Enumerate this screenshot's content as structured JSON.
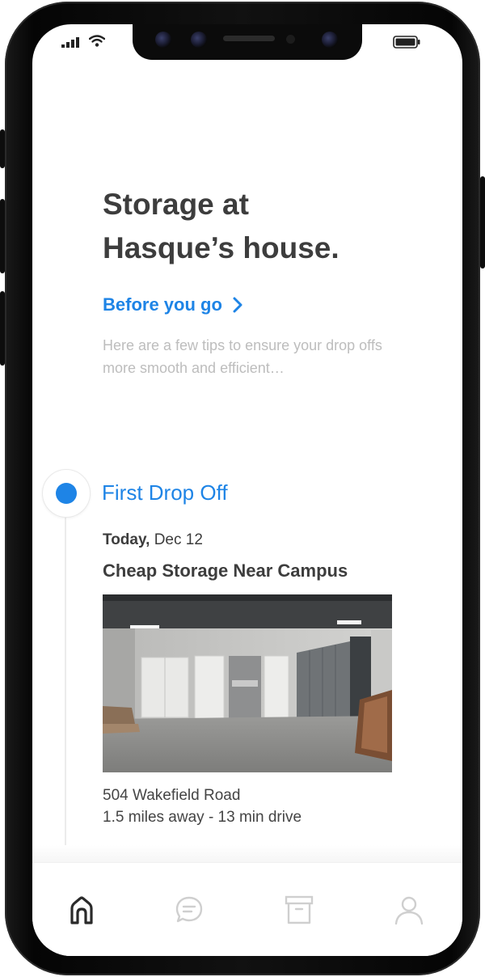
{
  "header": {
    "title_line1": "Storage at",
    "title_line2": "Hasque’s house."
  },
  "before_you_go": {
    "label": "Before you go",
    "icon": "chevron-right-icon",
    "description": "Here are a few tips to ensure your drop offs more smooth and efficient…"
  },
  "timeline": {
    "item_title": "First Drop Off",
    "date_prefix": "Today,",
    "date": "Dec 12",
    "storage_name": "Cheap Storage Near Campus",
    "address": "504 Wakefield Road",
    "distance": "1.5 miles away  - 13 min drive"
  },
  "tabbar": {
    "items": [
      {
        "icon": "home-icon",
        "active": true
      },
      {
        "icon": "chat-icon",
        "active": false
      },
      {
        "icon": "storage-box-icon",
        "active": false
      },
      {
        "icon": "profile-icon",
        "active": false
      }
    ]
  },
  "colors": {
    "accent": "#1e84e6",
    "title": "#3d3d3d",
    "muted": "#bdbdbd",
    "inactive_icon": "#cfcfcf"
  }
}
